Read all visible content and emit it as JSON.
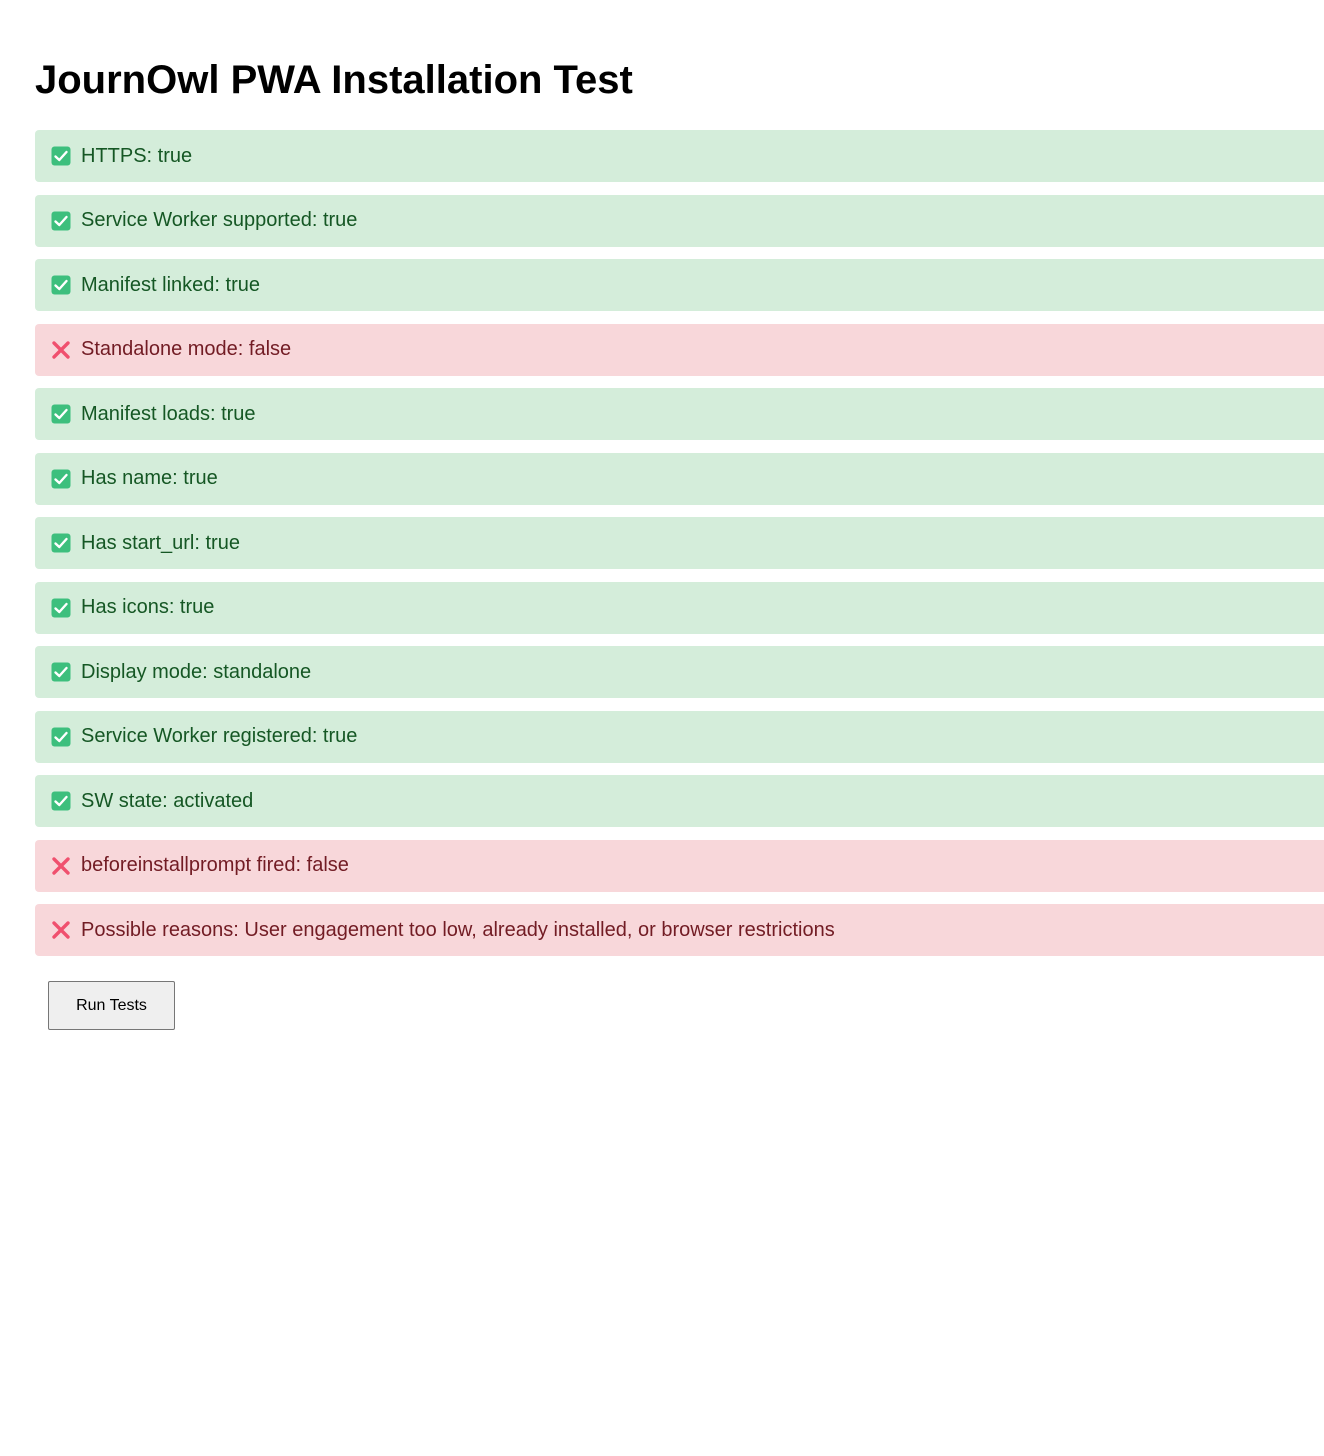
{
  "page": {
    "title": "JournOwl PWA Installation Test"
  },
  "colors": {
    "pass_bg": "#d4edda",
    "pass_text": "#155724",
    "fail_bg": "#f8d7da",
    "fail_text": "#721c24",
    "pass_icon": "#3dbf7d",
    "fail_icon": "#f0506e"
  },
  "results": [
    {
      "status": "pass",
      "icon": "check-box-icon",
      "text": "HTTPS: true"
    },
    {
      "status": "pass",
      "icon": "check-box-icon",
      "text": "Service Worker supported: true"
    },
    {
      "status": "pass",
      "icon": "check-box-icon",
      "text": "Manifest linked: true"
    },
    {
      "status": "fail",
      "icon": "cross-mark-icon",
      "text": "Standalone mode: false"
    },
    {
      "status": "pass",
      "icon": "check-box-icon",
      "text": "Manifest loads: true"
    },
    {
      "status": "pass",
      "icon": "check-box-icon",
      "text": "Has name: true"
    },
    {
      "status": "pass",
      "icon": "check-box-icon",
      "text": "Has start_url: true"
    },
    {
      "status": "pass",
      "icon": "check-box-icon",
      "text": "Has icons: true"
    },
    {
      "status": "pass",
      "icon": "check-box-icon",
      "text": "Display mode: standalone"
    },
    {
      "status": "pass",
      "icon": "check-box-icon",
      "text": "Service Worker registered: true"
    },
    {
      "status": "pass",
      "icon": "check-box-icon",
      "text": "SW state: activated"
    },
    {
      "status": "fail",
      "icon": "cross-mark-icon",
      "text": "beforeinstallprompt fired: false"
    },
    {
      "status": "fail",
      "icon": "cross-mark-icon",
      "text": "Possible reasons: User engagement too low, already installed, or browser restrictions"
    }
  ],
  "actions": {
    "run_label": "Run Tests"
  }
}
